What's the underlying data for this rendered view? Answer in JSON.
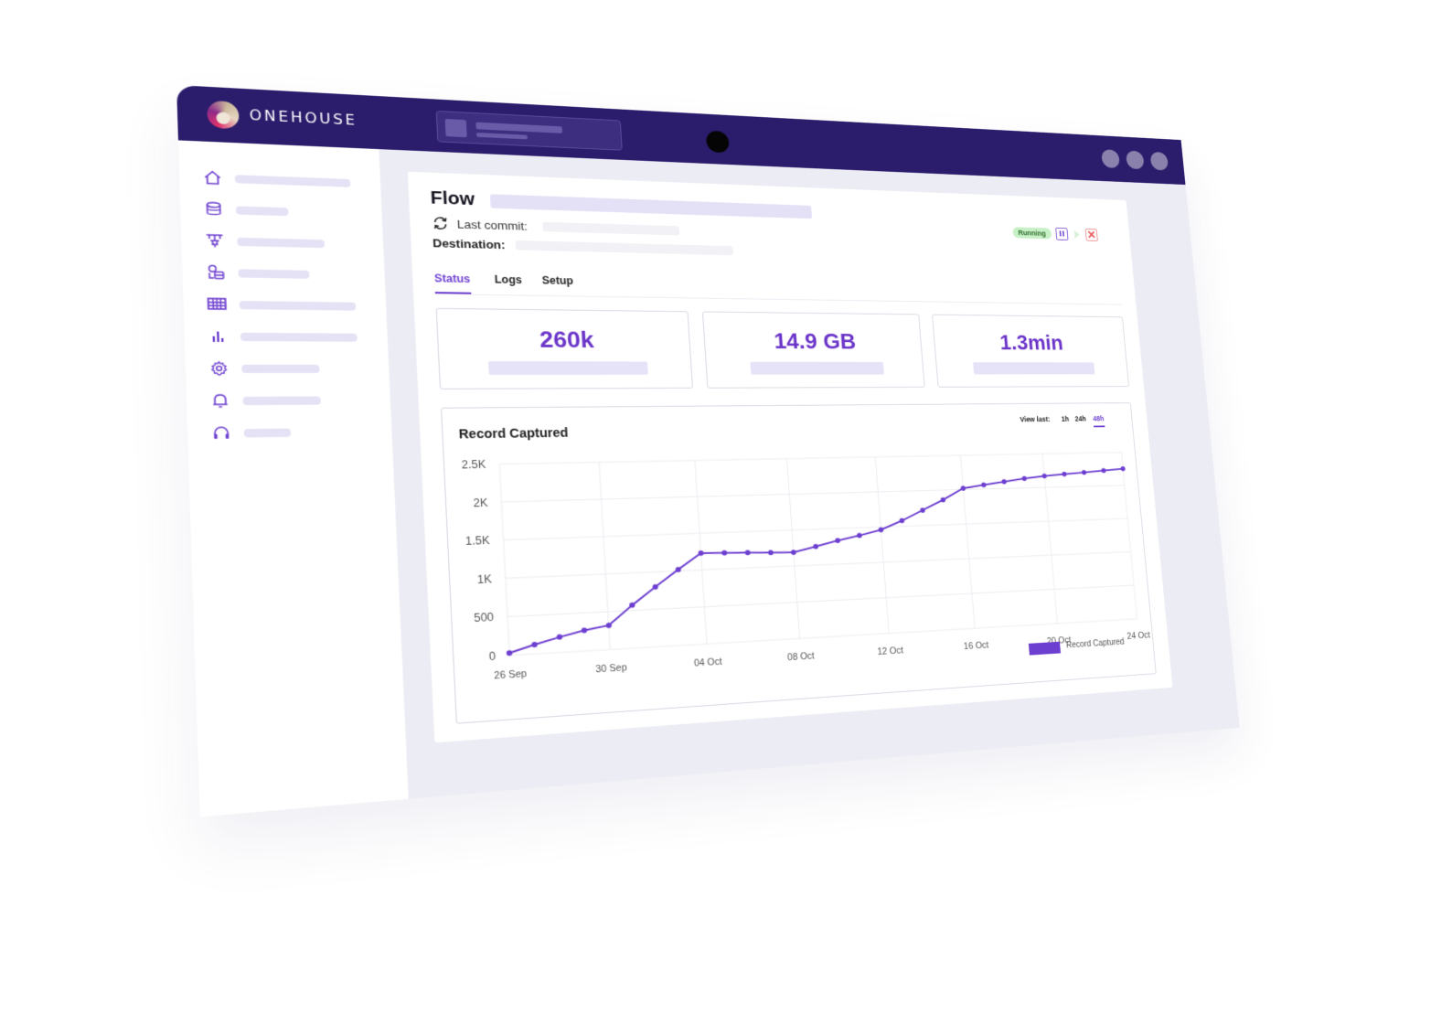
{
  "brand": {
    "name": "ONEHOUSE",
    "header_color": "#2c1c6c",
    "accent_color": "#6d3fd0"
  },
  "sidebar": {
    "items": [
      {
        "icon": "home-icon"
      },
      {
        "icon": "database-icon"
      },
      {
        "icon": "pipeline-icon"
      },
      {
        "icon": "data-sources-icon"
      },
      {
        "icon": "table-icon"
      },
      {
        "icon": "bar-chart-icon"
      },
      {
        "icon": "gear-icon"
      },
      {
        "icon": "bell-icon"
      },
      {
        "icon": "headset-icon"
      }
    ]
  },
  "flow": {
    "title": "Flow",
    "last_commit_label": "Last commit:",
    "destination_label": "Destination:",
    "status": "Running",
    "status_color": "#c8f0c6",
    "controls": [
      "pause-icon",
      "play-icon",
      "stop-icon"
    ]
  },
  "tabs": [
    {
      "label": "Status",
      "active": true
    },
    {
      "label": "Logs",
      "active": false
    },
    {
      "label": "Setup",
      "active": false
    }
  ],
  "stats": [
    {
      "value": "260k"
    },
    {
      "value": "14.9 GB"
    },
    {
      "value": "1.3min"
    }
  ],
  "chart": {
    "view_last_label": "View last:",
    "ranges": [
      {
        "label": "1h",
        "active": false
      },
      {
        "label": "24h",
        "active": false
      },
      {
        "label": "48h",
        "active": true
      }
    ]
  },
  "chart_data": {
    "type": "line",
    "title": "Record Captured",
    "xlabel": "",
    "ylabel": "",
    "ylim": [
      0,
      2500
    ],
    "yticks": [
      0,
      500,
      1000,
      1500,
      2000,
      2500
    ],
    "ytick_labels": [
      "0",
      "500",
      "1K",
      "1.5K",
      "2K",
      "2.5K"
    ],
    "xticks": [
      "26 Sep",
      "30 Sep",
      "04 Oct",
      "08 Oct",
      "12 Oct",
      "16 Oct",
      "20 Oct",
      "24 Oct"
    ],
    "grid": true,
    "legend": "bottom-right",
    "series": [
      {
        "name": "Record Captured",
        "color": "#6d3fd0",
        "x": [
          "26 Sep",
          "27 Sep",
          "28 Sep",
          "29 Sep",
          "30 Sep",
          "01 Oct",
          "02 Oct",
          "03 Oct",
          "04 Oct",
          "05 Oct",
          "06 Oct",
          "07 Oct",
          "08 Oct",
          "09 Oct",
          "10 Oct",
          "11 Oct",
          "12 Oct",
          "13 Oct",
          "14 Oct",
          "15 Oct",
          "16 Oct",
          "17 Oct",
          "18 Oct",
          "19 Oct",
          "20 Oct",
          "21 Oct",
          "22 Oct",
          "23 Oct",
          "24 Oct"
        ],
        "values": [
          30,
          120,
          200,
          270,
          320,
          570,
          800,
          1020,
          1230,
          1220,
          1210,
          1200,
          1190,
          1260,
          1330,
          1390,
          1460,
          1580,
          1720,
          1860,
          2020,
          2060,
          2100,
          2140,
          2170,
          2190,
          2210,
          2230,
          2250
        ]
      }
    ]
  }
}
